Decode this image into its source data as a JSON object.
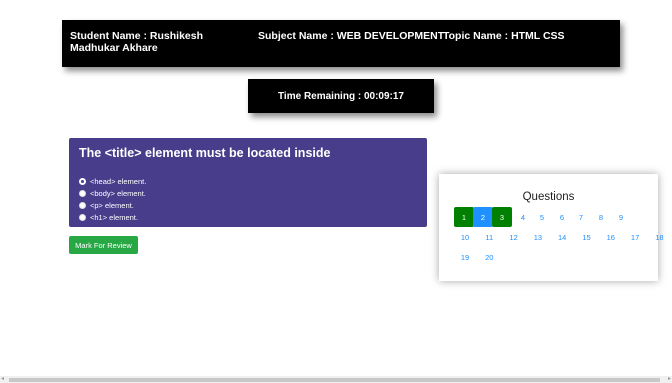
{
  "header": {
    "student": "Student Name : Rushikesh Madhukar Akhare",
    "subject": "Subject Name : WEB DEVELOPMENT",
    "topic": "Topic Name : HTML CSS"
  },
  "timer": "Time Remaining : 00:09:17",
  "question": {
    "title": "The <title> element must be located inside",
    "options": [
      "<head> element.",
      "<body> element.",
      "<p> element.",
      "<h1> element."
    ],
    "selected_index": 0
  },
  "mark_button": "Mark For Review",
  "panel": {
    "title": "Questions",
    "numbers": [
      "1",
      "2",
      "3",
      "4",
      "5",
      "6",
      "7",
      "8",
      "9",
      "10",
      "11",
      "12",
      "13",
      "14",
      "15",
      "16",
      "17",
      "18",
      "19",
      "20"
    ],
    "states": {
      "1": "answered",
      "2": "current",
      "3": "answered"
    },
    "colors": {
      "answered": "#008000",
      "current": "#1e90ff",
      "default_text": "#1e90ff"
    }
  },
  "colors": {
    "header_bg": "#000000",
    "question_bg": "#483d8b",
    "mark_btn": "#28a745"
  },
  "scrollbar": {
    "left_arrow": "◂",
    "right_arrow": "▸"
  }
}
